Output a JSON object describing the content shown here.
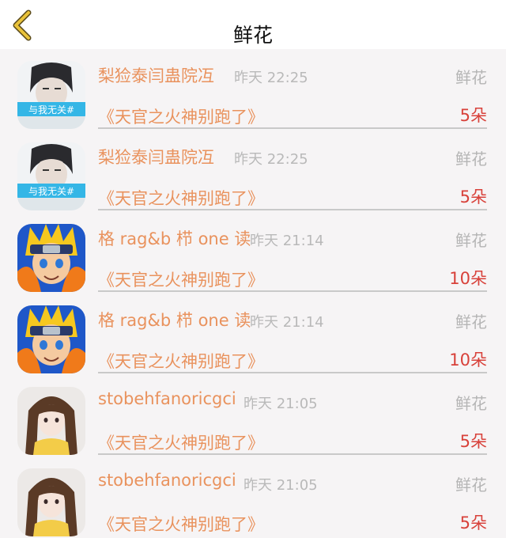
{
  "header": {
    "title": "鲜花",
    "back_icon": "chevron-left-icon",
    "back_color": "#e9c23a"
  },
  "rows": [
    {
      "name": "梨猃泰闫蛊院冱",
      "time": "昨天 22:25",
      "type": "鲜花",
      "book": "《天官之火神别跑了》",
      "count": "5朵",
      "avatar_text": "与我无关#",
      "avatar": "boy"
    },
    {
      "name": "梨猃泰闫蛊院冱",
      "time": "昨天 22:25",
      "type": "鲜花",
      "book": "《天官之火神别跑了》",
      "count": "5朵",
      "avatar_text": "与我无关#",
      "avatar": "boy"
    },
    {
      "name": "格 rag&b 栉 one 读",
      "time": "昨天 21:14",
      "type": "鲜花",
      "book": "《天官之火神别跑了》",
      "count": "10朵",
      "avatar": "naruto"
    },
    {
      "name": "格 rag&b 栉 one 读",
      "time": "昨天 21:14",
      "type": "鲜花",
      "book": "《天官之火神别跑了》",
      "count": "10朵",
      "avatar": "naruto"
    },
    {
      "name": "stobehfanoricgci",
      "time": "昨天 21:05",
      "type": "鲜花",
      "book": "《天官之火神别跑了》",
      "count": "5朵",
      "avatar": "girl"
    },
    {
      "name": "stobehfanoricgci",
      "time": "昨天 21:05",
      "type": "鲜花",
      "book": "《天官之火神别跑了》",
      "count": "5朵",
      "avatar": "girl"
    }
  ],
  "colors": {
    "accent_orange": "#e9925d",
    "count_red": "#d8413a",
    "muted_gray": "#b9b9b9",
    "background": "#f6f4f5"
  }
}
